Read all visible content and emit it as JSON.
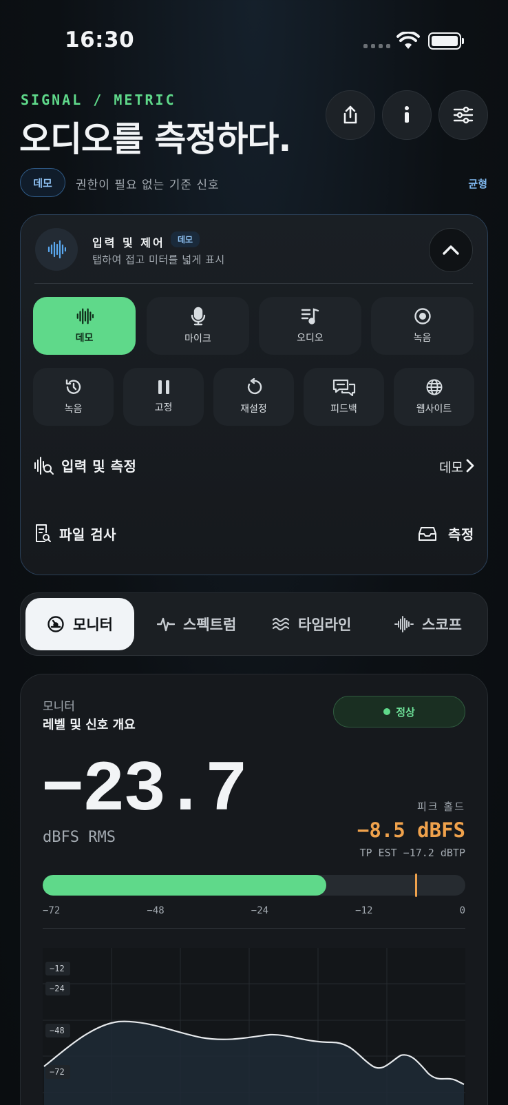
{
  "status_bar": {
    "time": "16:30"
  },
  "header": {
    "eyebrow": "SIGNAL / METRIC",
    "title": "오디오를 측정하다.",
    "actions": [
      "share-icon",
      "info-icon",
      "sliders-icon"
    ]
  },
  "source": {
    "pill": "데모",
    "description": "권한이 필요 없는 기준 신호",
    "mode": "균형"
  },
  "panel": {
    "title": "입력 및 제어",
    "badge": "데모",
    "subtitle": "탭하여 접고 미터를 넓게 표시",
    "row1": [
      {
        "label": "데모",
        "icon": "waveform-icon",
        "active": true
      },
      {
        "label": "마이크",
        "icon": "mic-icon",
        "active": false
      },
      {
        "label": "오디오",
        "icon": "music-list-icon",
        "active": false
      },
      {
        "label": "녹음",
        "icon": "record-icon",
        "active": false
      }
    ],
    "row2": [
      {
        "label": "녹음",
        "icon": "history-icon"
      },
      {
        "label": "고정",
        "icon": "pause-icon"
      },
      {
        "label": "재설정",
        "icon": "reset-icon"
      },
      {
        "label": "피드백",
        "icon": "chat-icon"
      },
      {
        "label": "웹사이트",
        "icon": "globe-icon"
      }
    ],
    "input_measure_label": "입력 및 측정",
    "input_measure_value": "데모",
    "file_check_label": "파일 검사",
    "measure_label": "측정"
  },
  "tabs": [
    {
      "label": "모니터",
      "icon": "gauge-icon",
      "active": true
    },
    {
      "label": "스펙트럼",
      "icon": "pulse-icon",
      "active": false
    },
    {
      "label": "타임라인",
      "icon": "waves-icon",
      "active": false
    },
    {
      "label": "스코프",
      "icon": "oscilloscope-icon",
      "active": false
    }
  ],
  "monitor": {
    "label": "모니터",
    "title": "레벨 및 신호 개요",
    "status": "정상",
    "status_color": "#5fd98a",
    "value": "−23.7",
    "unit": "dBFS RMS",
    "peak_label": "피크 홀드",
    "peak_value": "−8.5 dBFS",
    "tp_est": "TP EST −17.2 dBTP",
    "meter_min": -72,
    "meter_max": 0,
    "meter_rms": -23.7,
    "meter_peak": -8.5,
    "ticks": [
      "−72",
      "−48",
      "−24",
      "−12",
      "0"
    ],
    "plot_labels": [
      "−12",
      "−24",
      "−48",
      "−72"
    ]
  }
}
